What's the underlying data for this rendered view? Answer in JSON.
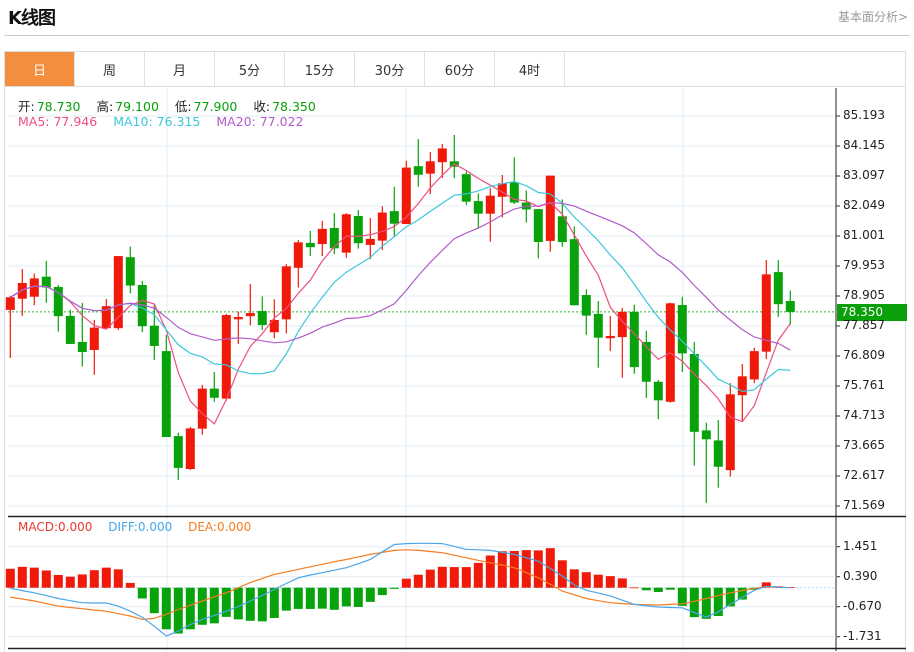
{
  "header": {
    "title": "K线图",
    "link": "基本面分析>"
  },
  "tabs": [
    "日",
    "周",
    "月",
    "5分",
    "15分",
    "30分",
    "60分",
    "4时"
  ],
  "active_tab": 0,
  "ohlc_legend": {
    "open_label": "开:",
    "open": "78.730",
    "high_label": "高:",
    "high": "79.100",
    "low_label": "低:",
    "low": "77.900",
    "close_label": "收:",
    "close": "78.350"
  },
  "ma_legend": {
    "ma5": "MA5: 77.946",
    "ma10": "MA10: 76.315",
    "ma20": "MA20: 77.022"
  },
  "macd_legend": {
    "macd": "MACD:0.000",
    "diff": "DIFF:0.000",
    "dea": "DEA:0.000"
  },
  "current_price": "78.350",
  "colors": {
    "up": "#f01a0a",
    "down": "#08a20a",
    "ma5": "#ee4f80",
    "ma10": "#3cc8dc",
    "ma20": "#b35ccb",
    "diff": "#4aa6ea",
    "dea": "#f57c22",
    "tab_active": "#f28e3e"
  },
  "chart_data": [
    {
      "type": "candlestick",
      "title": "K线图",
      "price_ticks": [
        "85.193",
        "84.145",
        "83.097",
        "82.049",
        "81.001",
        "79.953",
        "78.905",
        "77.857",
        "76.809",
        "75.761",
        "74.713",
        "73.665",
        "72.617",
        "71.569"
      ],
      "ylim": [
        71.569,
        85.193
      ],
      "ma_periods": [
        5,
        10,
        20
      ],
      "candles": [
        [
          78.42,
          78.91,
          76.74,
          78.86
        ],
        [
          78.81,
          79.85,
          78.21,
          79.36
        ],
        [
          78.88,
          79.69,
          78.58,
          79.52
        ],
        [
          79.58,
          80.13,
          78.67,
          79.2
        ],
        [
          79.22,
          79.29,
          77.66,
          78.2
        ],
        [
          78.21,
          78.42,
          77.23,
          77.23
        ],
        [
          77.3,
          78.66,
          76.44,
          76.95
        ],
        [
          77.02,
          78.07,
          76.15,
          77.8
        ],
        [
          77.78,
          78.8,
          77.75,
          78.55
        ],
        [
          77.78,
          80.3,
          77.72,
          80.3
        ],
        [
          80.26,
          80.63,
          79.0,
          79.27
        ],
        [
          79.29,
          79.43,
          77.64,
          77.85
        ],
        [
          77.87,
          78.63,
          76.67,
          77.16
        ],
        [
          76.98,
          77.54,
          73.98,
          73.98
        ],
        [
          74.01,
          74.13,
          72.48,
          72.9
        ],
        [
          72.86,
          74.33,
          72.83,
          74.28
        ],
        [
          74.27,
          75.8,
          74.06,
          75.67
        ],
        [
          75.67,
          76.25,
          75.21,
          75.35
        ],
        [
          75.32,
          78.28,
          75.25,
          78.24
        ],
        [
          78.09,
          78.36,
          77.23,
          78.17
        ],
        [
          78.2,
          79.32,
          77.88,
          78.31
        ],
        [
          78.38,
          78.89,
          77.72,
          77.89
        ],
        [
          77.64,
          78.79,
          77.43,
          78.07
        ],
        [
          78.09,
          80.02,
          77.6,
          79.94
        ],
        [
          79.89,
          80.86,
          79.2,
          80.78
        ],
        [
          80.76,
          81.18,
          80.3,
          80.61
        ],
        [
          80.72,
          81.53,
          80.3,
          81.25
        ],
        [
          81.28,
          81.8,
          80.36,
          80.57
        ],
        [
          80.42,
          81.8,
          80.24,
          81.76
        ],
        [
          81.7,
          81.91,
          80.56,
          80.75
        ],
        [
          80.69,
          81.63,
          80.19,
          80.9
        ],
        [
          80.84,
          82.04,
          80.51,
          81.82
        ],
        [
          81.87,
          82.72,
          81.0,
          81.43
        ],
        [
          81.42,
          83.63,
          81.42,
          83.39
        ],
        [
          83.44,
          84.39,
          82.72,
          83.14
        ],
        [
          83.18,
          83.94,
          82.47,
          83.61
        ],
        [
          83.58,
          84.22,
          83.03,
          84.06
        ],
        [
          83.61,
          84.53,
          83.02,
          83.42
        ],
        [
          83.16,
          83.25,
          82.09,
          82.2
        ],
        [
          82.22,
          82.49,
          81.25,
          81.78
        ],
        [
          81.78,
          82.67,
          80.8,
          82.41
        ],
        [
          82.37,
          83.13,
          81.65,
          82.84
        ],
        [
          82.88,
          83.75,
          82.12,
          82.17
        ],
        [
          82.17,
          82.59,
          81.47,
          81.93
        ],
        [
          81.94,
          81.94,
          80.22,
          80.79
        ],
        [
          80.83,
          83.11,
          80.45,
          83.11
        ],
        [
          81.69,
          82.28,
          80.62,
          80.79
        ],
        [
          80.89,
          81.34,
          78.58,
          78.58
        ],
        [
          78.94,
          79.14,
          77.55,
          78.22
        ],
        [
          78.28,
          78.73,
          76.4,
          77.45
        ],
        [
          77.43,
          78.21,
          76.98,
          77.51
        ],
        [
          77.47,
          78.49,
          76.05,
          78.35
        ],
        [
          78.35,
          78.6,
          76.19,
          76.42
        ],
        [
          77.3,
          77.69,
          75.34,
          75.91
        ],
        [
          75.91,
          75.97,
          74.6,
          75.26
        ],
        [
          75.21,
          78.67,
          75.18,
          78.65
        ],
        [
          78.59,
          78.88,
          76.25,
          76.9
        ],
        [
          76.88,
          77.3,
          72.98,
          74.16
        ],
        [
          74.21,
          74.48,
          71.68,
          73.9
        ],
        [
          73.86,
          74.57,
          72.21,
          72.94
        ],
        [
          72.82,
          75.86,
          72.59,
          75.47
        ],
        [
          75.44,
          76.53,
          74.54,
          76.1
        ],
        [
          75.99,
          77.1,
          75.86,
          76.98
        ],
        [
          76.96,
          80.16,
          76.7,
          79.66
        ],
        [
          79.74,
          80.16,
          78.18,
          78.62
        ],
        [
          78.73,
          79.1,
          77.9,
          78.35
        ]
      ]
    },
    {
      "type": "macd",
      "ticks": [
        "1.451",
        "0.390",
        "-0.670",
        "-1.731"
      ],
      "tick_values": [
        1.451,
        0.39,
        -0.67,
        -1.731
      ],
      "histogram": [
        0.67,
        0.74,
        0.71,
        0.61,
        0.45,
        0.39,
        0.47,
        0.62,
        0.71,
        0.65,
        0.17,
        -0.38,
        -0.9,
        -1.47,
        -1.62,
        -1.47,
        -1.31,
        -1.26,
        -1.03,
        -1.12,
        -1.17,
        -1.19,
        -1.07,
        -0.81,
        -0.75,
        -0.75,
        -0.74,
        -0.78,
        -0.66,
        -0.68,
        -0.5,
        -0.26,
        -0.04,
        0.32,
        0.46,
        0.64,
        0.74,
        0.73,
        0.73,
        0.88,
        1.14,
        1.29,
        1.3,
        1.33,
        1.32,
        1.4,
        0.97,
        0.65,
        0.55,
        0.46,
        0.41,
        0.33,
        0.01,
        -0.09,
        -0.15,
        -0.07,
        -0.64,
        -1.04,
        -1.1,
        -1.0,
        -0.66,
        -0.42,
        -0.07,
        0.19,
        0.05,
        0.02
      ],
      "diff": [
        -0.02,
        -0.1,
        -0.18,
        -0.28,
        -0.38,
        -0.46,
        -0.53,
        -0.54,
        -0.54,
        -0.65,
        -0.83,
        -1.05,
        -1.36,
        -1.71,
        -1.53,
        -1.3,
        -1.12,
        -0.98,
        -0.83,
        -0.66,
        -0.47,
        -0.27,
        -0.06,
        0.15,
        0.35,
        0.45,
        0.53,
        0.62,
        0.71,
        0.85,
        1.0,
        1.27,
        1.53,
        1.56,
        1.57,
        1.57,
        1.56,
        1.46,
        1.36,
        1.34,
        1.32,
        1.25,
        1.18,
        1.06,
        0.94,
        0.68,
        0.41,
        0.1,
        -0.09,
        -0.19,
        -0.29,
        -0.44,
        -0.59,
        -0.64,
        -0.68,
        -0.7,
        -0.71,
        -0.88,
        -1.04,
        -0.85,
        -0.59,
        -0.34,
        -0.09,
        0.05,
        0.02,
        0.0
      ],
      "dea": [
        -0.33,
        -0.4,
        -0.47,
        -0.56,
        -0.65,
        -0.7,
        -0.74,
        -0.79,
        -0.83,
        -0.92,
        -1.0,
        -1.12,
        -1.08,
        -0.94,
        -0.77,
        -0.62,
        -0.47,
        -0.32,
        -0.18,
        0.0,
        0.18,
        0.33,
        0.47,
        0.56,
        0.65,
        0.74,
        0.83,
        0.92,
        1.0,
        1.09,
        1.18,
        1.25,
        1.32,
        1.34,
        1.32,
        1.28,
        1.24,
        1.15,
        1.06,
        0.97,
        0.88,
        0.8,
        0.71,
        0.53,
        0.35,
        0.12,
        -0.12,
        -0.25,
        -0.38,
        -0.46,
        -0.53,
        -0.56,
        -0.59,
        -0.6,
        -0.61,
        -0.59,
        -0.57,
        -0.48,
        -0.38,
        -0.28,
        -0.18,
        -0.1,
        -0.02,
        0.03,
        0.02,
        0.0
      ]
    }
  ]
}
